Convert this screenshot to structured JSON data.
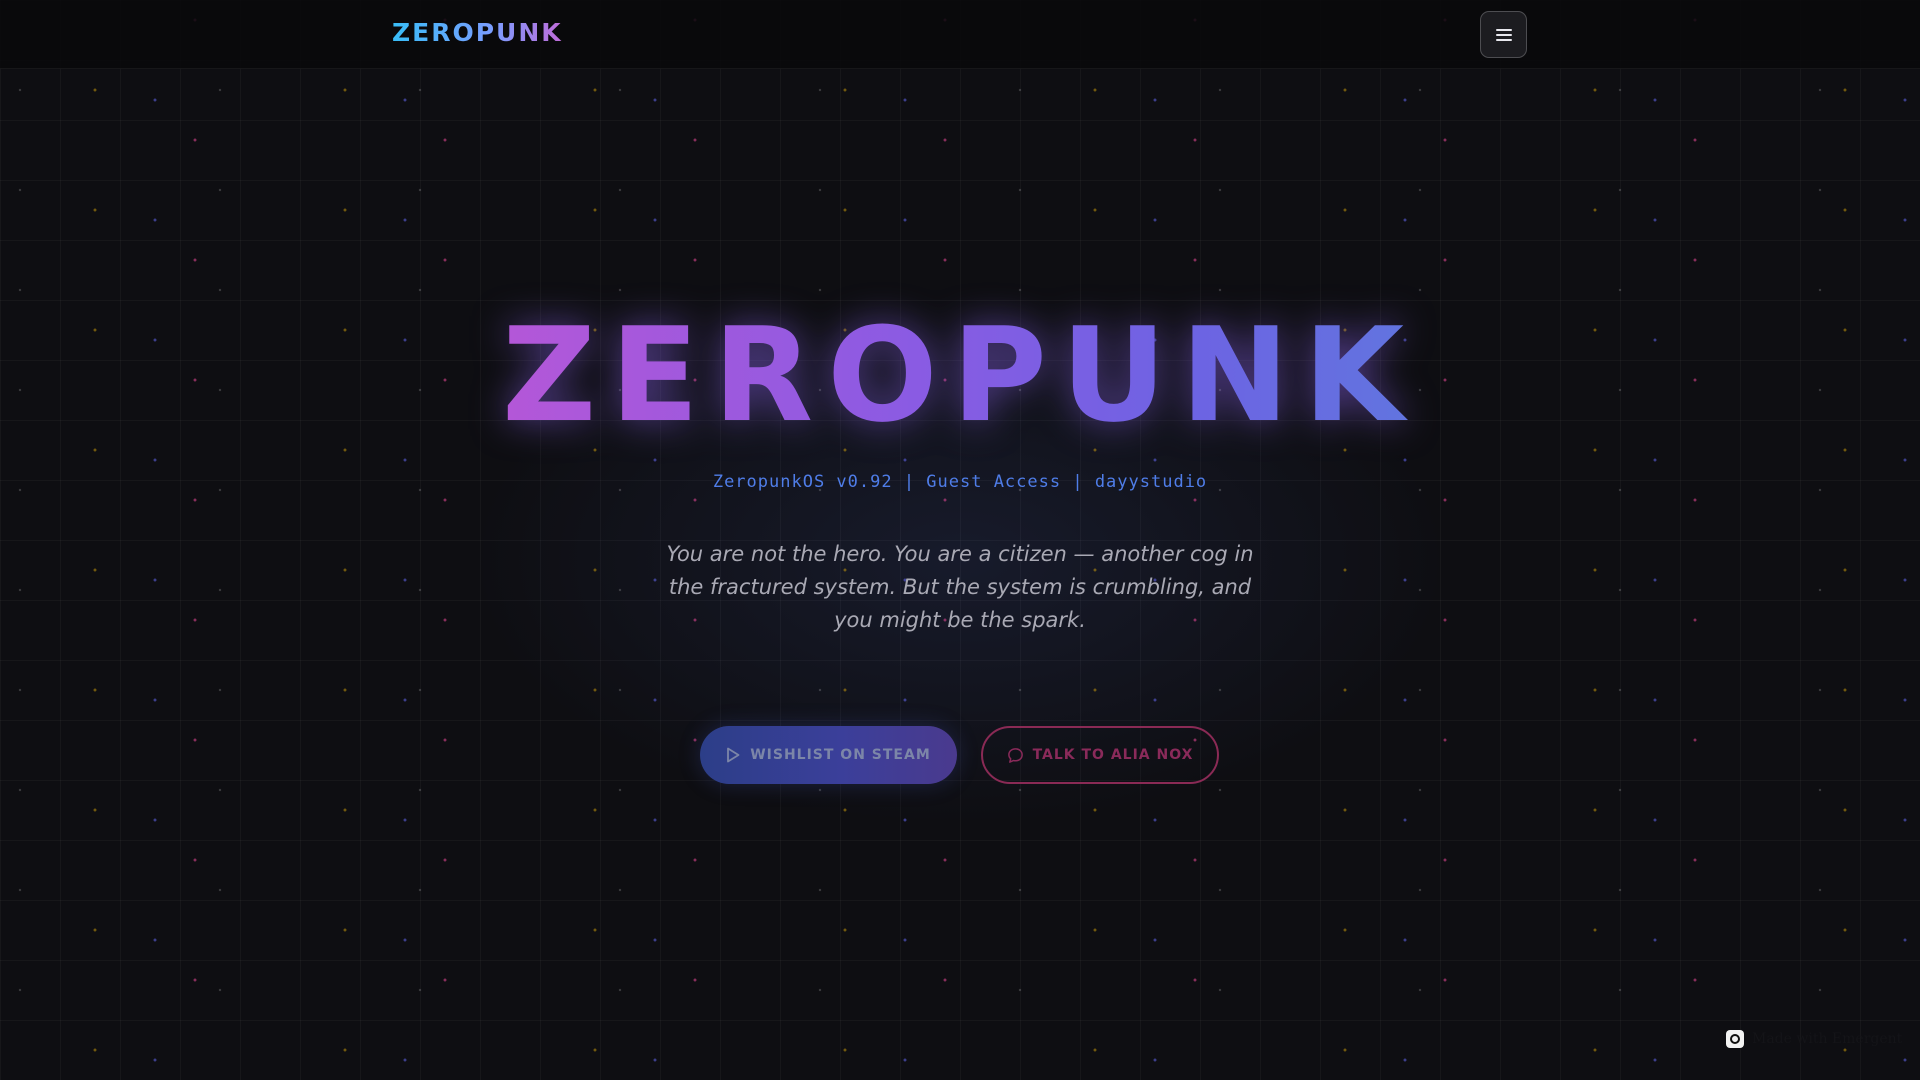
{
  "header": {
    "brand": "ZEROPUNK",
    "menu_icon": "hamburger-menu-icon"
  },
  "hero": {
    "title": "ZEROPUNK",
    "subtitle": "ZeropunkOS v0.92 | Guest Access | dayystudio",
    "tagline": "You are not the hero. You are a citizen — another cog in the fractured system. But the system is crumbling, and you might be the spark."
  },
  "actions": {
    "wishlist_label": "WISHLIST ON STEAM",
    "wishlist_icon": "play-icon",
    "talk_label": "TALK TO ALIA NOX",
    "talk_icon": "chat-bubble-icon"
  },
  "footer_badge": {
    "text": "Made with Emergent",
    "icon": "emergent-logo-icon"
  },
  "colors": {
    "background": "#0e0e12",
    "brand_gradient_start": "#38bdf8",
    "brand_gradient_end": "#c06bd8",
    "title_gradient_start": "#b457d8",
    "title_gradient_end": "#6175df",
    "subtitle": "#4f7de8",
    "steam_button": "#3b3f9a",
    "alia_button_border": "#8a2a55"
  }
}
